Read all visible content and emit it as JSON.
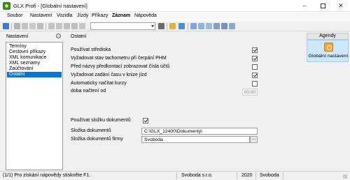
{
  "window": {
    "title": "GLX Profi - [Globální nastavení]"
  },
  "menubar": [
    "Soubor",
    "Nastavení",
    "Vozidla",
    "Jízdy",
    "Příkazy",
    "Záznam",
    "Nápověda"
  ],
  "nav": {
    "header": "Nastavení",
    "items": [
      "Termíny",
      "Cestovní příkazy",
      "XML komunikace",
      "XML seznamy",
      "Zaúčtování",
      "Ostatní"
    ],
    "selected": "Ostatní"
  },
  "main": {
    "section_title": "Ostatní",
    "options": [
      {
        "label": "Používat střediska",
        "checked": true
      },
      {
        "label": "Vyžadovat stav tachometru při čerpání PHM",
        "checked": true
      },
      {
        "label": "Před názvy předkontací zobrazovat čísla účtů",
        "checked": false
      },
      {
        "label": "Vyžadovat zadání času v knize jízd",
        "checked": true
      },
      {
        "label": "Automaticky načítat kurzy",
        "checked": false
      }
    ],
    "doba_label": "doba načtení od",
    "doba_value": "00:00",
    "use_docs_label": "Používat složku dokumentů",
    "use_docs_checked": true,
    "docs_folder_label": "Složka dokumentů",
    "docs_folder_value": "C:\\GLX_12400\\Dokumenty\\",
    "firm_folder_label": "Složka dokumentů firmy",
    "firm_folder_value": "Svoboda",
    "browse_label": "..."
  },
  "agendy": {
    "header": "Agendy",
    "tile_label": "Globální nastavení"
  },
  "status": {
    "hint": "(1/1) Pro získání nápovědy stiskněte F1.",
    "company": "Svoboda s.r.o.",
    "year": "2020",
    "user": "Svoboda"
  },
  "colors": {
    "selection": "#0078d7",
    "agendy_tile": "#cce8ff"
  }
}
